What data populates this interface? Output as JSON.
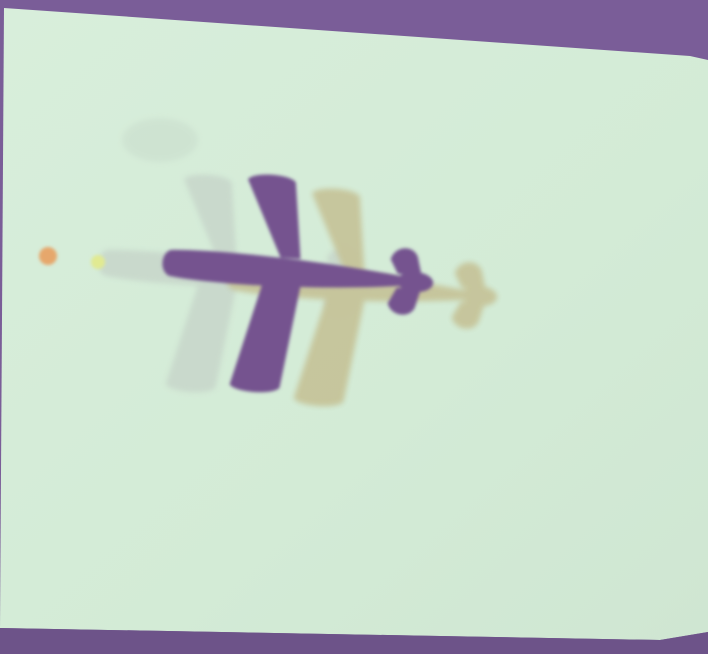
{
  "scene": {
    "frame_color": "#7a5d98",
    "screen_color": "#d4ecd8",
    "description_colors": {
      "plane_main": "#73508f",
      "plane_ghost_left": "#c9d6c9",
      "plane_ghost_right": "#c9c79c",
      "dot_orange": "#e9a970",
      "dot_yellow": "#e3ea9a"
    },
    "icons": [
      "airplane-icon",
      "airplane-icon",
      "airplane-icon",
      "dot",
      "dot"
    ]
  }
}
